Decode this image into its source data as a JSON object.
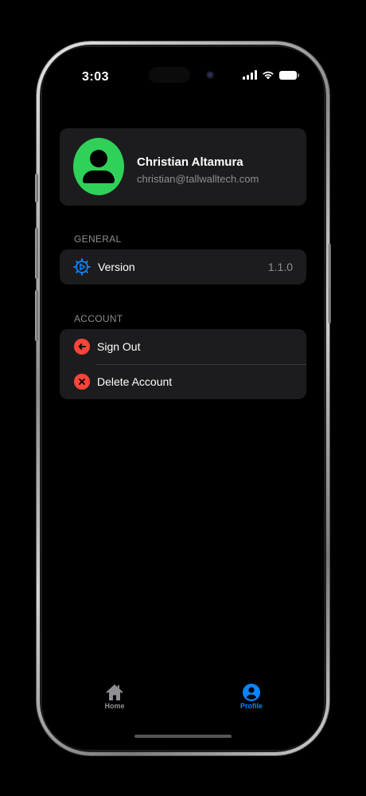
{
  "status_bar": {
    "time": "3:03"
  },
  "profile": {
    "name": "Christian Altamura",
    "email": "christian@tallwalltech.com",
    "avatar_color": "#30d158"
  },
  "sections": {
    "general": {
      "title": "GENERAL",
      "version_label": "Version",
      "version_value": "1.1.0",
      "version_icon": "gear-icon"
    },
    "account": {
      "title": "ACCOUNT",
      "sign_out_label": "Sign Out",
      "sign_out_icon": "arrow-left-circle-icon",
      "delete_label": "Delete Account",
      "delete_icon": "x-circle-icon"
    }
  },
  "tab_bar": {
    "home_label": "Home",
    "profile_label": "Profile",
    "active_tab": "Profile",
    "active_color": "#0a84ff",
    "inactive_color": "#8e8e93"
  },
  "colors": {
    "destructive": "#ff453a",
    "card": "#1c1c1e",
    "background": "#000000"
  }
}
